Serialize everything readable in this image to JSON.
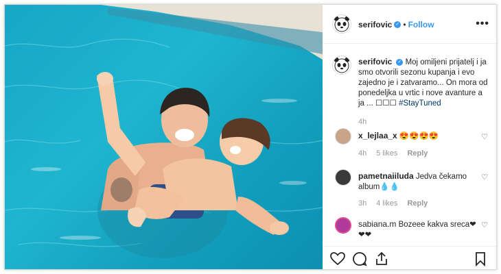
{
  "post": {
    "username": "serifovic",
    "follow_label": "Follow",
    "separator": "•",
    "more_label": "•••"
  },
  "caption": {
    "username": "serifovic",
    "text": "Moj omiljeni prijatelj i ja smo otvorili sezonu kupanja i evo zajedno je i zatvaramo... On mora od ponedeljka u vrtic i nove avanture a ja ... ",
    "emojis": "☐☐☐",
    "hashtag": "#StayTuned",
    "time": "4h"
  },
  "comments": [
    {
      "username": "x_lejlaa_x",
      "text": "😍😍😍😍",
      "time": "4h",
      "likes": "5 likes",
      "reply": "Reply"
    },
    {
      "username": "pametnaiiluda",
      "text": "Jedva čekamo album💧💧",
      "time": "3h",
      "likes": "4 likes",
      "reply": "Reply"
    },
    {
      "username": "sabiana.m",
      "text": "Bozeee kakva sreca❤ ❤❤",
      "time": "",
      "likes": "",
      "reply": ""
    }
  ],
  "icons": {
    "like": "heart-icon",
    "comment": "comment-icon",
    "share": "share-icon",
    "save": "bookmark-icon"
  },
  "colors": {
    "accent": "#3897f0",
    "hashtag": "#003569",
    "pool": "#1fb5cf"
  }
}
